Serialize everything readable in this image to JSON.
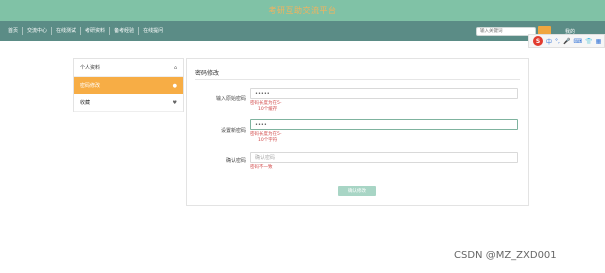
{
  "banner": {
    "title": "考研互助交流平台"
  },
  "nav": {
    "items": [
      "首页",
      "交流中心",
      "在线测试",
      "考研资料",
      "备考经验",
      "在线提问"
    ]
  },
  "search": {
    "placeholder": "输入关键词"
  },
  "user": {
    "menu": "我的"
  },
  "ime": {
    "logo": "S",
    "label": "中"
  },
  "sidebar": {
    "items": [
      {
        "label": "个人资料",
        "icon": "home-icon"
      },
      {
        "label": "密码修改",
        "icon": "user-icon",
        "active": true
      },
      {
        "label": "收藏",
        "icon": "heart-icon"
      }
    ]
  },
  "panel": {
    "title": "密码修改",
    "fields": [
      {
        "label": "输入原始密码",
        "value": "•••••",
        "hint_line1": "密码长度为在5-",
        "hint_line2": "10个缓存"
      },
      {
        "label": "设置新密码",
        "value": "••••",
        "hint_line1": "密码长度为在5-",
        "hint_line2": "10个字符"
      },
      {
        "label": "确认密码",
        "placeholder": "确认密码",
        "hint_line1": "密码不一致"
      }
    ],
    "submit": "确认修改"
  },
  "watermark": "CSDN @MZ_ZXD001"
}
